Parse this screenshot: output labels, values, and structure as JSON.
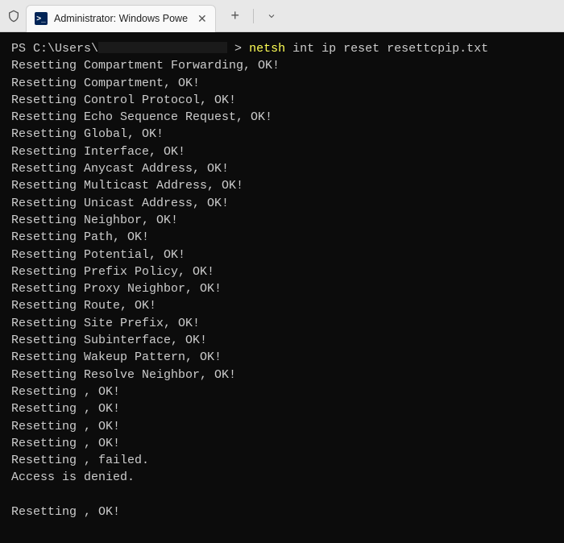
{
  "window": {
    "tab_title": "Administrator: Windows Powe",
    "tab_icon_text": ">_"
  },
  "prompt": {
    "prefix": "PS C:\\Users\\",
    "gt": ">",
    "command_highlight": "netsh",
    "command_rest": " int ip reset resettcpip.txt"
  },
  "output_lines": [
    "Resetting Compartment Forwarding, OK!",
    "Resetting Compartment, OK!",
    "Resetting Control Protocol, OK!",
    "Resetting Echo Sequence Request, OK!",
    "Resetting Global, OK!",
    "Resetting Interface, OK!",
    "Resetting Anycast Address, OK!",
    "Resetting Multicast Address, OK!",
    "Resetting Unicast Address, OK!",
    "Resetting Neighbor, OK!",
    "Resetting Path, OK!",
    "Resetting Potential, OK!",
    "Resetting Prefix Policy, OK!",
    "Resetting Proxy Neighbor, OK!",
    "Resetting Route, OK!",
    "Resetting Site Prefix, OK!",
    "Resetting Subinterface, OK!",
    "Resetting Wakeup Pattern, OK!",
    "Resetting Resolve Neighbor, OK!",
    "Resetting , OK!",
    "Resetting , OK!",
    "Resetting , OK!",
    "Resetting , OK!",
    "Resetting , failed.",
    "Access is denied.",
    "",
    "Resetting , OK!"
  ]
}
